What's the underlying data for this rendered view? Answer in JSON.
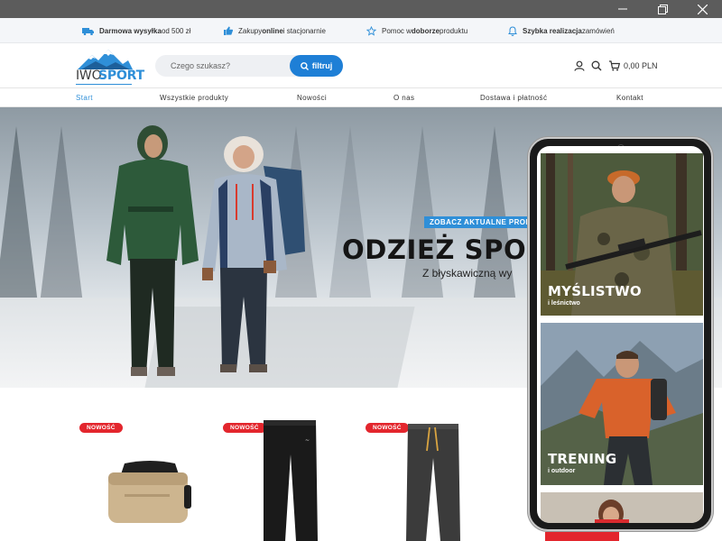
{
  "infobar": {
    "items": [
      {
        "icon": "truck-icon",
        "bold": "Darmowa wysyłka",
        "text": " od 500 zł"
      },
      {
        "icon": "thumbs-up-icon",
        "pre": "Zakupy ",
        "bold": "online",
        "text": " i stacjonarnie"
      },
      {
        "icon": "star-icon",
        "pre": "Pomoc w ",
        "bold": "doborze",
        "text": " produktu"
      },
      {
        "icon": "bell-icon",
        "bold": "Szybka realizacja",
        "text": " zamówień"
      }
    ]
  },
  "header": {
    "logo_part1": "IWO",
    "logo_part2": "SPORT",
    "search_placeholder": "Czego szukasz?",
    "search_button": "filtruj",
    "cart_total": "0,00 PLN"
  },
  "nav": {
    "items": [
      "Start",
      "Wszystkie produkty",
      "Nowości",
      "O nas",
      "Dostawa i płatność",
      "Kontakt"
    ]
  },
  "hero": {
    "badge": "ZOBACZ AKTUALNE PROM",
    "title": "ODZIEŻ SPOR",
    "subtitle": "Z błyskawiczną wy"
  },
  "products": {
    "badge": "NOWOŚĆ"
  },
  "phone": {
    "tiles": [
      {
        "title": "MYŚLISTWO",
        "subtitle": "i leśnictwo"
      },
      {
        "title": "TRENING",
        "subtitle": "i outdoor"
      }
    ]
  },
  "colors": {
    "accent": "#2f8fd8",
    "badge_red": "#e3262d",
    "titlebar": "#5c5c5c"
  }
}
